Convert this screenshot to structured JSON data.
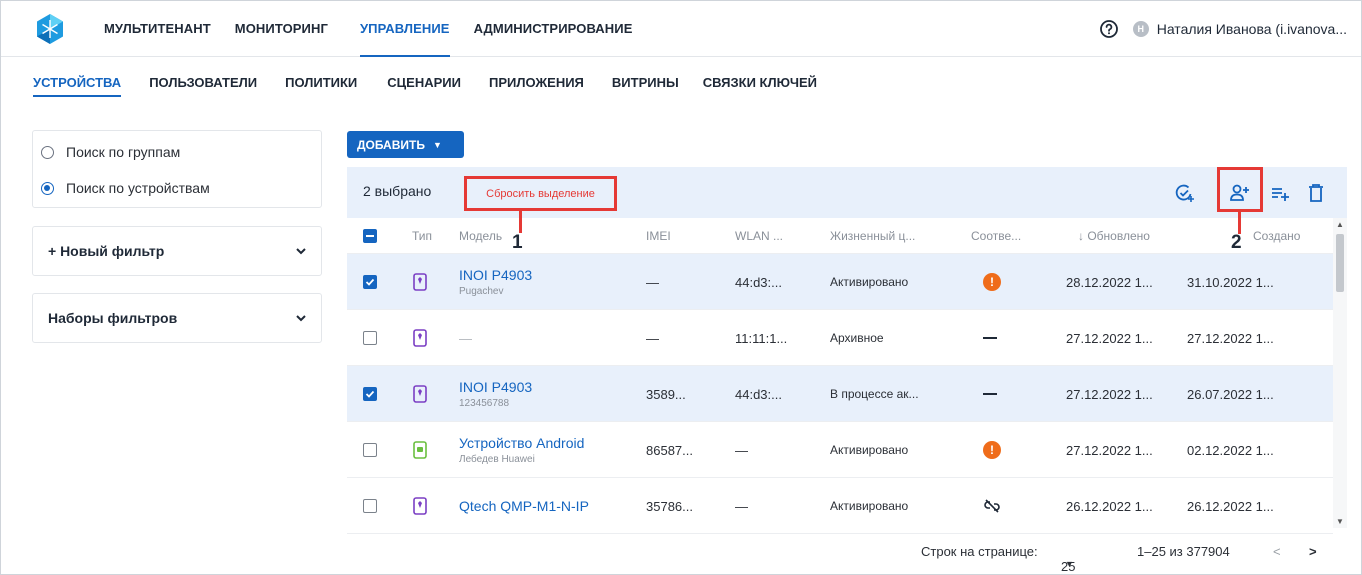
{
  "header": {
    "nav": [
      "МУЛЬТИТЕНАНТ",
      "МОНИТОРИНГ",
      "УПРАВЛЕНИЕ",
      "АДМИНИСТРИРОВАНИЕ"
    ],
    "active_nav": "УПРАВЛЕНИЕ",
    "user_initial": "Н",
    "user_name": "Наталия Иванова (i.ivanova..."
  },
  "subnav": {
    "items": [
      "УСТРОЙСТВА",
      "ПОЛЬЗОВАТЕЛИ",
      "ПОЛИТИКИ",
      "СЦЕНАРИИ",
      "ПРИЛОЖЕНИЯ",
      "ВИТРИНЫ",
      "СВЯЗКИ КЛЮЧЕЙ"
    ],
    "active": "УСТРОЙСТВА"
  },
  "sidebar": {
    "search_by_groups": "Поиск по группам",
    "search_by_devices": "Поиск по устройствам",
    "selected_mode": "devices",
    "new_filter": "+ Новый фильтр",
    "filter_sets": "Наборы фильтров"
  },
  "toolbar": {
    "add_label": "ДОБАВИТЬ",
    "selected_text": "2 выбрано",
    "reset_selection": "Сбросить выделение"
  },
  "table": {
    "headers": {
      "type": "Тип",
      "model": "Модель",
      "imei": "IMEI",
      "wlan": "WLAN ...",
      "lifecycle": "Жизненный ц...",
      "compliance": "Соотве...",
      "updated": "Обновлено",
      "created": "Создано"
    },
    "rows": [
      {
        "selected": true,
        "device": "phone",
        "model": "INOI P4903",
        "sub": "Pugachev",
        "imei": "—",
        "wlan": "44:d3:...",
        "lifecycle": "Активировано",
        "compliance": "warning",
        "updated": "28.12.2022 1...",
        "created": "31.10.2022 1..."
      },
      {
        "selected": false,
        "device": "phone",
        "model": "—",
        "sub": "",
        "imei": "—",
        "wlan": "11:11:1...",
        "lifecycle": "Архивное",
        "compliance": "none",
        "updated": "27.12.2022 1...",
        "created": "27.12.2022 1..."
      },
      {
        "selected": true,
        "device": "phone",
        "model": "INOI P4903",
        "sub": "123456788",
        "imei": "3589...",
        "wlan": "44:d3:...",
        "lifecycle": "В процессе ак...",
        "compliance": "none",
        "updated": "27.12.2022 1...",
        "created": "26.07.2022 1..."
      },
      {
        "selected": false,
        "device": "android",
        "model": "Устройство Android",
        "sub": "Лебедев Huawei",
        "imei": "86587...",
        "wlan": "—",
        "lifecycle": "Активировано",
        "compliance": "warning",
        "updated": "27.12.2022 1...",
        "created": "02.12.2022 1..."
      },
      {
        "selected": false,
        "device": "phone",
        "model": "Qtech QMP-M1-N-IP",
        "sub": "",
        "imei": "35786...",
        "wlan": "—",
        "lifecycle": "Активировано",
        "compliance": "unlinked",
        "updated": "26.12.2022 1...",
        "created": "26.12.2022 1..."
      }
    ]
  },
  "pager": {
    "rows_label": "Строк на странице:",
    "rows_value": "25",
    "range": "1–25 из 377904"
  },
  "annotations": {
    "one": "1",
    "two": "2"
  },
  "colors": {
    "accent": "#1565c0",
    "highlight": "#e53935",
    "warning": "#ef6c1a",
    "selected_row": "#e8f0fb"
  }
}
